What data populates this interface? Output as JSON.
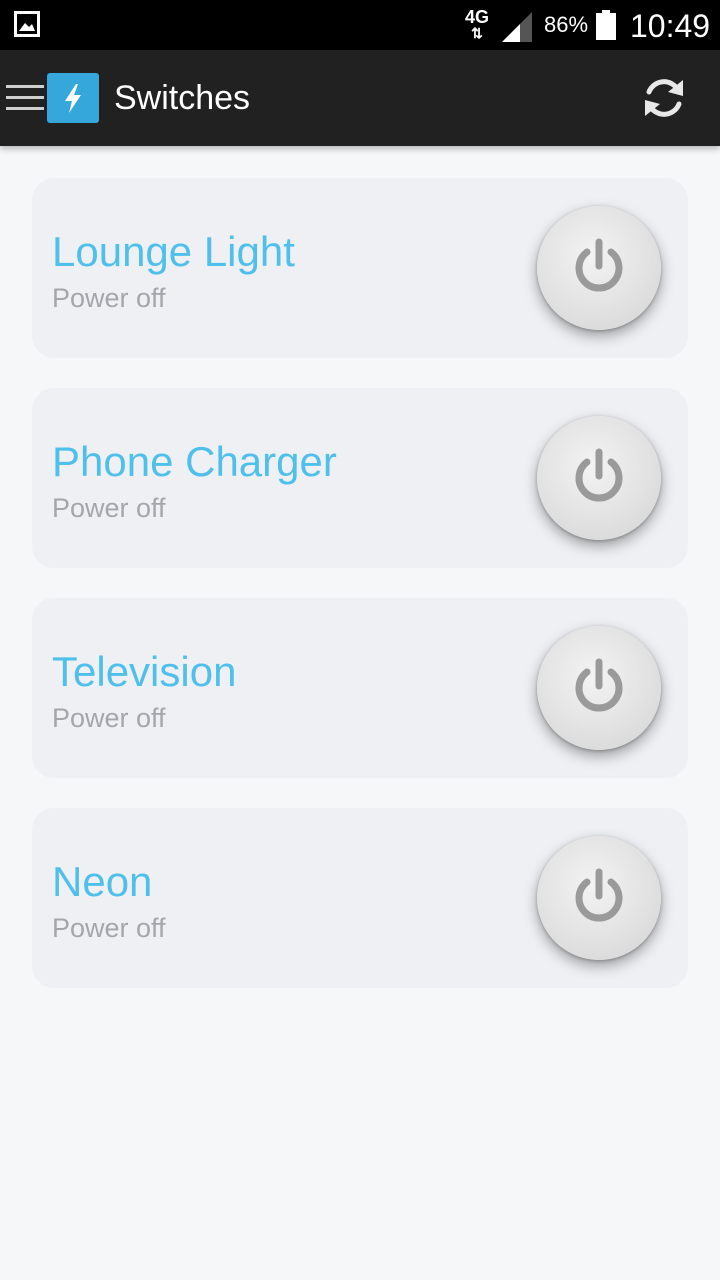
{
  "status_bar": {
    "network": "4G",
    "network_arrows": "⇅",
    "battery_percent": "86%",
    "time": "10:49",
    "icons": [
      "gallery-icon",
      "signal-icon",
      "battery-icon"
    ]
  },
  "app_bar": {
    "title": "Switches",
    "icons": [
      "menu-icon",
      "lightning-icon",
      "refresh-icon"
    ],
    "accent_color": "#35a7db"
  },
  "switches": [
    {
      "name": "Lounge Light",
      "status": "Power off"
    },
    {
      "name": "Phone Charger",
      "status": "Power off"
    },
    {
      "name": "Television",
      "status": "Power off"
    },
    {
      "name": "Neon",
      "status": "Power off"
    }
  ],
  "colors": {
    "name_text": "#4fc0eb",
    "status_text": "#a3a7ad",
    "card_bg": "#eef0f3",
    "appbar_bg": "#212121"
  }
}
